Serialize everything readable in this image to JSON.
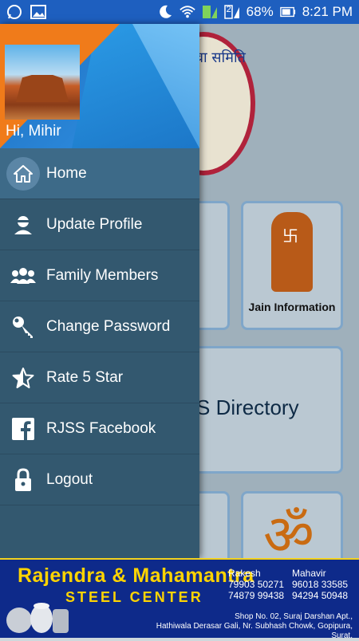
{
  "status_bar": {
    "battery": "68%",
    "time": "8:21 PM",
    "sim_badge": "2"
  },
  "background_app": {
    "logo_text": "वा समिति",
    "jain_info_label": "Jain Information",
    "directory_label": "S Directory"
  },
  "drawer": {
    "greeting": "Hi, Mihir",
    "menu": [
      {
        "label": "Home",
        "icon": "home-icon",
        "active": true
      },
      {
        "label": "Update Profile",
        "icon": "person-icon"
      },
      {
        "label": "Family Members",
        "icon": "group-icon"
      },
      {
        "label": "Change Password",
        "icon": "key-icon"
      },
      {
        "label": "Rate 5 Star",
        "icon": "star-icon"
      },
      {
        "label": "RJSS Facebook",
        "icon": "facebook-icon"
      },
      {
        "label": "Logout",
        "icon": "lock-icon"
      }
    ]
  },
  "banner": {
    "title": "Rajendra & Mahamantra",
    "subtitle": "STEEL CENTER",
    "contact1_name": "Rakesh",
    "contact1_phone1": "79903 50271",
    "contact1_phone2": "74879 99438",
    "contact2_name": "Mahavir",
    "contact2_phone1": "96018 33585",
    "contact2_phone2": "94294 50948",
    "address_line1": "Shop No. 02, Suraj Darshan Apt.,",
    "address_line2": "Hathiwala Derasar Gali, Nr. Subhash Chowk, Gopipura, Surat."
  },
  "colors": {
    "status_bar": "#1e5fbf",
    "drawer_bg": "#33586f",
    "drawer_active": "#3d6a88",
    "banner_bg": "#0e2a8a",
    "banner_accent": "#ffd400",
    "header_orange": "#f07b1a"
  }
}
